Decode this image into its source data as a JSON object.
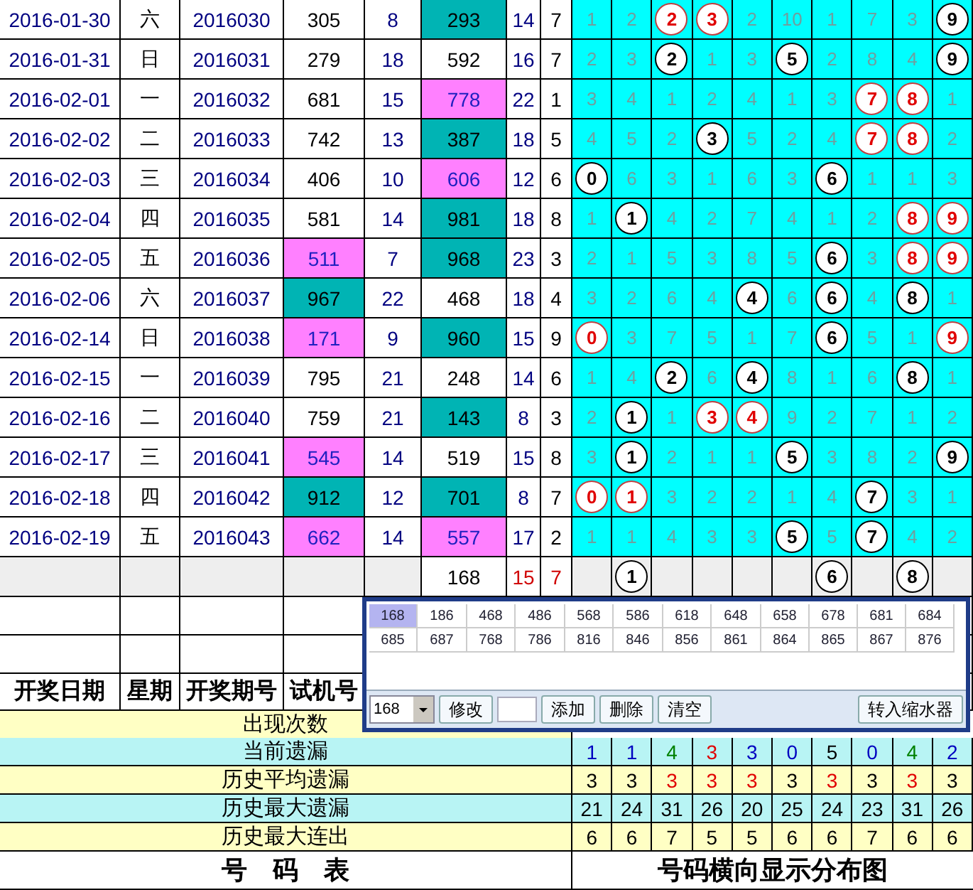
{
  "rows": [
    {
      "date": "2016-01-30",
      "weekday": "六",
      "period": "2016030",
      "trial": {
        "text": "305"
      },
      "column_5": "8",
      "result": {
        "text": "293",
        "color": "#00b4b4"
      },
      "column_7": "14",
      "column_8": "7",
      "distribution": [
        {
          "kind": "miss",
          "value": "1"
        },
        {
          "kind": "miss",
          "value": "2"
        },
        {
          "kind": "red_ball",
          "value": "2"
        },
        {
          "kind": "red_ball",
          "value": "3"
        },
        {
          "kind": "miss",
          "value": "2"
        },
        {
          "kind": "miss",
          "value": "10"
        },
        {
          "kind": "miss",
          "value": "1"
        },
        {
          "kind": "miss",
          "value": "7"
        },
        {
          "kind": "miss",
          "value": "3"
        },
        {
          "kind": "ball",
          "value": "9"
        }
      ]
    },
    {
      "date": "2016-01-31",
      "weekday": "日",
      "period": "2016031",
      "trial": {
        "text": "279"
      },
      "column_5": "18",
      "result": {
        "text": "592"
      },
      "column_7": "16",
      "column_8": "7",
      "distribution": [
        {
          "kind": "miss",
          "value": "2"
        },
        {
          "kind": "miss",
          "value": "3"
        },
        {
          "kind": "ball",
          "value": "2"
        },
        {
          "kind": "miss",
          "value": "1"
        },
        {
          "kind": "miss",
          "value": "3"
        },
        {
          "kind": "ball",
          "value": "5"
        },
        {
          "kind": "miss",
          "value": "2"
        },
        {
          "kind": "miss",
          "value": "8"
        },
        {
          "kind": "miss",
          "value": "4"
        },
        {
          "kind": "ball",
          "value": "9"
        }
      ]
    },
    {
      "date": "2016-02-01",
      "weekday": "一",
      "period": "2016032",
      "trial": {
        "text": "681"
      },
      "column_5": "15",
      "result": {
        "text": "778",
        "color": "#ff80ff"
      },
      "column_7": "22",
      "column_8": "1",
      "distribution": [
        {
          "kind": "miss",
          "value": "3"
        },
        {
          "kind": "miss",
          "value": "4"
        },
        {
          "kind": "miss",
          "value": "1"
        },
        {
          "kind": "miss",
          "value": "2"
        },
        {
          "kind": "miss",
          "value": "4"
        },
        {
          "kind": "miss",
          "value": "1"
        },
        {
          "kind": "miss",
          "value": "3"
        },
        {
          "kind": "red_ball",
          "value": "7"
        },
        {
          "kind": "red_ball",
          "value": "8"
        },
        {
          "kind": "miss",
          "value": "1"
        }
      ]
    },
    {
      "date": "2016-02-02",
      "weekday": "二",
      "period": "2016033",
      "trial": {
        "text": "742"
      },
      "column_5": "13",
      "result": {
        "text": "387",
        "color": "#00b4b4"
      },
      "column_7": "18",
      "column_8": "5",
      "distribution": [
        {
          "kind": "miss",
          "value": "4"
        },
        {
          "kind": "miss",
          "value": "5"
        },
        {
          "kind": "miss",
          "value": "2"
        },
        {
          "kind": "ball",
          "value": "3"
        },
        {
          "kind": "miss",
          "value": "5"
        },
        {
          "kind": "miss",
          "value": "2"
        },
        {
          "kind": "miss",
          "value": "4"
        },
        {
          "kind": "red_ball",
          "value": "7"
        },
        {
          "kind": "red_ball",
          "value": "8"
        },
        {
          "kind": "miss",
          "value": "2"
        }
      ]
    },
    {
      "date": "2016-02-03",
      "weekday": "三",
      "period": "2016034",
      "trial": {
        "text": "406"
      },
      "column_5": "10",
      "result": {
        "text": "606",
        "color": "#ff80ff"
      },
      "column_7": "12",
      "column_8": "6",
      "distribution": [
        {
          "kind": "ball",
          "value": "0"
        },
        {
          "kind": "miss",
          "value": "6"
        },
        {
          "kind": "miss",
          "value": "3"
        },
        {
          "kind": "miss",
          "value": "1"
        },
        {
          "kind": "miss",
          "value": "6"
        },
        {
          "kind": "miss",
          "value": "3"
        },
        {
          "kind": "ball",
          "value": "6"
        },
        {
          "kind": "miss",
          "value": "1"
        },
        {
          "kind": "miss",
          "value": "1"
        },
        {
          "kind": "miss",
          "value": "3"
        }
      ]
    },
    {
      "date": "2016-02-04",
      "weekday": "四",
      "period": "2016035",
      "trial": {
        "text": "581"
      },
      "column_5": "14",
      "result": {
        "text": "981",
        "color": "#00b4b4"
      },
      "column_7": "18",
      "column_8": "8",
      "distribution": [
        {
          "kind": "miss",
          "value": "1"
        },
        {
          "kind": "ball",
          "value": "1"
        },
        {
          "kind": "miss",
          "value": "4"
        },
        {
          "kind": "miss",
          "value": "2"
        },
        {
          "kind": "miss",
          "value": "7"
        },
        {
          "kind": "miss",
          "value": "4"
        },
        {
          "kind": "miss",
          "value": "1"
        },
        {
          "kind": "miss",
          "value": "2"
        },
        {
          "kind": "red_ball",
          "value": "8"
        },
        {
          "kind": "red_ball",
          "value": "9"
        }
      ]
    },
    {
      "date": "2016-02-05",
      "weekday": "五",
      "period": "2016036",
      "trial": {
        "text": "511",
        "color": "#ff80ff"
      },
      "column_5": "7",
      "result": {
        "text": "968",
        "color": "#00b4b4"
      },
      "column_7": "23",
      "column_8": "3",
      "distribution": [
        {
          "kind": "miss",
          "value": "2"
        },
        {
          "kind": "miss",
          "value": "1"
        },
        {
          "kind": "miss",
          "value": "5"
        },
        {
          "kind": "miss",
          "value": "3"
        },
        {
          "kind": "miss",
          "value": "8"
        },
        {
          "kind": "miss",
          "value": "5"
        },
        {
          "kind": "ball",
          "value": "6"
        },
        {
          "kind": "miss",
          "value": "3"
        },
        {
          "kind": "red_ball",
          "value": "8"
        },
        {
          "kind": "red_ball",
          "value": "9"
        }
      ]
    },
    {
      "date": "2016-02-06",
      "weekday": "六",
      "period": "2016037",
      "trial": {
        "text": "967",
        "color": "#00b4b4"
      },
      "column_5": "22",
      "result": {
        "text": "468"
      },
      "column_7": "18",
      "column_8": "4",
      "distribution": [
        {
          "kind": "miss",
          "value": "3"
        },
        {
          "kind": "miss",
          "value": "2"
        },
        {
          "kind": "miss",
          "value": "6"
        },
        {
          "kind": "miss",
          "value": "4"
        },
        {
          "kind": "ball",
          "value": "4"
        },
        {
          "kind": "miss",
          "value": "6"
        },
        {
          "kind": "ball",
          "value": "6"
        },
        {
          "kind": "miss",
          "value": "4"
        },
        {
          "kind": "ball",
          "value": "8"
        },
        {
          "kind": "miss",
          "value": "1"
        }
      ]
    },
    {
      "date": "2016-02-14",
      "weekday": "日",
      "period": "2016038",
      "trial": {
        "text": "171",
        "color": "#ff80ff"
      },
      "column_5": "9",
      "result": {
        "text": "960",
        "color": "#00b4b4"
      },
      "column_7": "15",
      "column_8": "9",
      "distribution": [
        {
          "kind": "red_ball",
          "value": "0"
        },
        {
          "kind": "miss",
          "value": "3"
        },
        {
          "kind": "miss",
          "value": "7"
        },
        {
          "kind": "miss",
          "value": "5"
        },
        {
          "kind": "miss",
          "value": "1"
        },
        {
          "kind": "miss",
          "value": "7"
        },
        {
          "kind": "ball",
          "value": "6"
        },
        {
          "kind": "miss",
          "value": "5"
        },
        {
          "kind": "miss",
          "value": "1"
        },
        {
          "kind": "red_ball",
          "value": "9"
        }
      ]
    },
    {
      "date": "2016-02-15",
      "weekday": "一",
      "period": "2016039",
      "trial": {
        "text": "795"
      },
      "column_5": "21",
      "result": {
        "text": "248"
      },
      "column_7": "14",
      "column_8": "6",
      "distribution": [
        {
          "kind": "miss",
          "value": "1"
        },
        {
          "kind": "miss",
          "value": "4"
        },
        {
          "kind": "ball",
          "value": "2"
        },
        {
          "kind": "miss",
          "value": "6"
        },
        {
          "kind": "ball",
          "value": "4"
        },
        {
          "kind": "miss",
          "value": "8"
        },
        {
          "kind": "miss",
          "value": "1"
        },
        {
          "kind": "miss",
          "value": "6"
        },
        {
          "kind": "ball",
          "value": "8"
        },
        {
          "kind": "miss",
          "value": "1"
        }
      ]
    },
    {
      "date": "2016-02-16",
      "weekday": "二",
      "period": "2016040",
      "trial": {
        "text": "759"
      },
      "column_5": "21",
      "result": {
        "text": "143",
        "color": "#00b4b4"
      },
      "column_7": "8",
      "column_8": "3",
      "distribution": [
        {
          "kind": "miss",
          "value": "2"
        },
        {
          "kind": "ball",
          "value": "1"
        },
        {
          "kind": "miss",
          "value": "1"
        },
        {
          "kind": "red_ball",
          "value": "3"
        },
        {
          "kind": "red_ball",
          "value": "4"
        },
        {
          "kind": "miss",
          "value": "9"
        },
        {
          "kind": "miss",
          "value": "2"
        },
        {
          "kind": "miss",
          "value": "7"
        },
        {
          "kind": "miss",
          "value": "1"
        },
        {
          "kind": "miss",
          "value": "2"
        }
      ]
    },
    {
      "date": "2016-02-17",
      "weekday": "三",
      "period": "2016041",
      "trial": {
        "text": "545",
        "color": "#ff80ff"
      },
      "column_5": "14",
      "result": {
        "text": "519"
      },
      "column_7": "15",
      "column_8": "8",
      "distribution": [
        {
          "kind": "miss",
          "value": "3"
        },
        {
          "kind": "ball",
          "value": "1"
        },
        {
          "kind": "miss",
          "value": "2"
        },
        {
          "kind": "miss",
          "value": "1"
        },
        {
          "kind": "miss",
          "value": "1"
        },
        {
          "kind": "ball",
          "value": "5"
        },
        {
          "kind": "miss",
          "value": "3"
        },
        {
          "kind": "miss",
          "value": "8"
        },
        {
          "kind": "miss",
          "value": "2"
        },
        {
          "kind": "ball",
          "value": "9"
        }
      ]
    },
    {
      "date": "2016-02-18",
      "weekday": "四",
      "period": "2016042",
      "trial": {
        "text": "912",
        "color": "#00b4b4"
      },
      "column_5": "12",
      "result": {
        "text": "701",
        "color": "#00b4b4"
      },
      "column_7": "8",
      "column_8": "7",
      "distribution": [
        {
          "kind": "red_ball",
          "value": "0"
        },
        {
          "kind": "red_ball",
          "value": "1"
        },
        {
          "kind": "miss",
          "value": "3"
        },
        {
          "kind": "miss",
          "value": "2"
        },
        {
          "kind": "miss",
          "value": "2"
        },
        {
          "kind": "miss",
          "value": "1"
        },
        {
          "kind": "miss",
          "value": "4"
        },
        {
          "kind": "ball",
          "value": "7"
        },
        {
          "kind": "miss",
          "value": "3"
        },
        {
          "kind": "miss",
          "value": "1"
        }
      ]
    },
    {
      "date": "2016-02-19",
      "weekday": "五",
      "period": "2016043",
      "trial": {
        "text": "662",
        "color": "#ff80ff"
      },
      "column_5": "14",
      "result": {
        "text": "557",
        "color": "#ff80ff"
      },
      "column_7": "17",
      "column_8": "2",
      "distribution": [
        {
          "kind": "miss",
          "value": "1"
        },
        {
          "kind": "miss",
          "value": "1"
        },
        {
          "kind": "miss",
          "value": "4"
        },
        {
          "kind": "miss",
          "value": "3"
        },
        {
          "kind": "miss",
          "value": "3"
        },
        {
          "kind": "ball",
          "value": "5"
        },
        {
          "kind": "miss",
          "value": "5"
        },
        {
          "kind": "ball",
          "value": "7"
        },
        {
          "kind": "miss",
          "value": "4"
        },
        {
          "kind": "miss",
          "value": "2"
        }
      ]
    }
  ],
  "total_row": {
    "result": "168",
    "column_7": "15",
    "column_8": "7",
    "distribution": [
      {
        "kind": "blank"
      },
      {
        "kind": "ball",
        "value": "1"
      },
      {
        "kind": "blank"
      },
      {
        "kind": "blank"
      },
      {
        "kind": "blank"
      },
      {
        "kind": "blank"
      },
      {
        "kind": "ball",
        "value": "6"
      },
      {
        "kind": "blank"
      },
      {
        "kind": "ball",
        "value": "8"
      },
      {
        "kind": "blank"
      }
    ]
  },
  "header": [
    "开奖日期",
    "星期",
    "开奖期号",
    "试机号"
  ],
  "stats": [
    {
      "label": "出现次数",
      "color": "#ffffc4"
    },
    {
      "label": "当前遗漏",
      "color": "#b8f4f4",
      "values": [
        {
          "value": "1",
          "color": "#0000c0"
        },
        {
          "value": "1",
          "color": "#0000c0"
        },
        {
          "value": "4",
          "color": "#008000"
        },
        {
          "value": "3",
          "color": "#e00000"
        },
        {
          "value": "3",
          "color": "#0000c0"
        },
        {
          "value": "0",
          "color": "#0000c0"
        },
        {
          "value": "5",
          "color": "#000000"
        },
        {
          "value": "0",
          "color": "#0000c0"
        },
        {
          "value": "4",
          "color": "#008000"
        },
        {
          "value": "2",
          "color": "#0000c0"
        }
      ]
    },
    {
      "label": "历史平均遗漏",
      "color": "#ffffc4",
      "values": [
        {
          "value": "3",
          "color": "#000000"
        },
        {
          "value": "3",
          "color": "#000000"
        },
        {
          "value": "3",
          "color": "#e00000"
        },
        {
          "value": "3",
          "color": "#e00000"
        },
        {
          "value": "3",
          "color": "#e00000"
        },
        {
          "value": "3",
          "color": "#000000"
        },
        {
          "value": "3",
          "color": "#e00000"
        },
        {
          "value": "3",
          "color": "#000000"
        },
        {
          "value": "3",
          "color": "#e00000"
        },
        {
          "value": "3",
          "color": "#000000"
        }
      ]
    },
    {
      "label": "历史最大遗漏",
      "color": "#b8f4f4",
      "values": [
        {
          "value": "21"
        },
        {
          "value": "24"
        },
        {
          "value": "31"
        },
        {
          "value": "26"
        },
        {
          "value": "20"
        },
        {
          "value": "25"
        },
        {
          "value": "24"
        },
        {
          "value": "23"
        },
        {
          "value": "31"
        },
        {
          "value": "26"
        }
      ]
    },
    {
      "label": "历史最大连出",
      "color": "#ffffc4",
      "values": [
        {
          "value": "6"
        },
        {
          "value": "6"
        },
        {
          "value": "7"
        },
        {
          "value": "5"
        },
        {
          "value": "5"
        },
        {
          "value": "6"
        },
        {
          "value": "6"
        },
        {
          "value": "7"
        },
        {
          "value": "6"
        },
        {
          "value": "6"
        }
      ]
    }
  ],
  "footer": {
    "left": "号　码　表",
    "right": "号码横向显示分布图"
  },
  "popup": {
    "numbers": [
      {
        "value": "168",
        "selected": true
      },
      {
        "value": "186",
        "selected": false
      },
      {
        "value": "468",
        "selected": false
      },
      {
        "value": "486",
        "selected": false
      },
      {
        "value": "568",
        "selected": false
      },
      {
        "value": "586",
        "selected": false
      },
      {
        "value": "618",
        "selected": false
      },
      {
        "value": "648",
        "selected": false
      },
      {
        "value": "658",
        "selected": false
      },
      {
        "value": "678",
        "selected": false
      },
      {
        "value": "681",
        "selected": false
      },
      {
        "value": "684",
        "selected": false
      },
      {
        "value": "685",
        "selected": false
      },
      {
        "value": "687",
        "selected": false
      },
      {
        "value": "768",
        "selected": false
      },
      {
        "value": "786",
        "selected": false
      },
      {
        "value": "816",
        "selected": false
      },
      {
        "value": "846",
        "selected": false
      },
      {
        "value": "856",
        "selected": false
      },
      {
        "value": "861",
        "selected": false
      },
      {
        "value": "864",
        "selected": false
      },
      {
        "value": "865",
        "selected": false
      },
      {
        "value": "867",
        "selected": false
      },
      {
        "value": "876",
        "selected": false
      }
    ],
    "select_value": "168",
    "buttons": [
      "修改",
      "添加",
      "删除",
      "清空"
    ],
    "transfer_button": "转入缩水器"
  }
}
